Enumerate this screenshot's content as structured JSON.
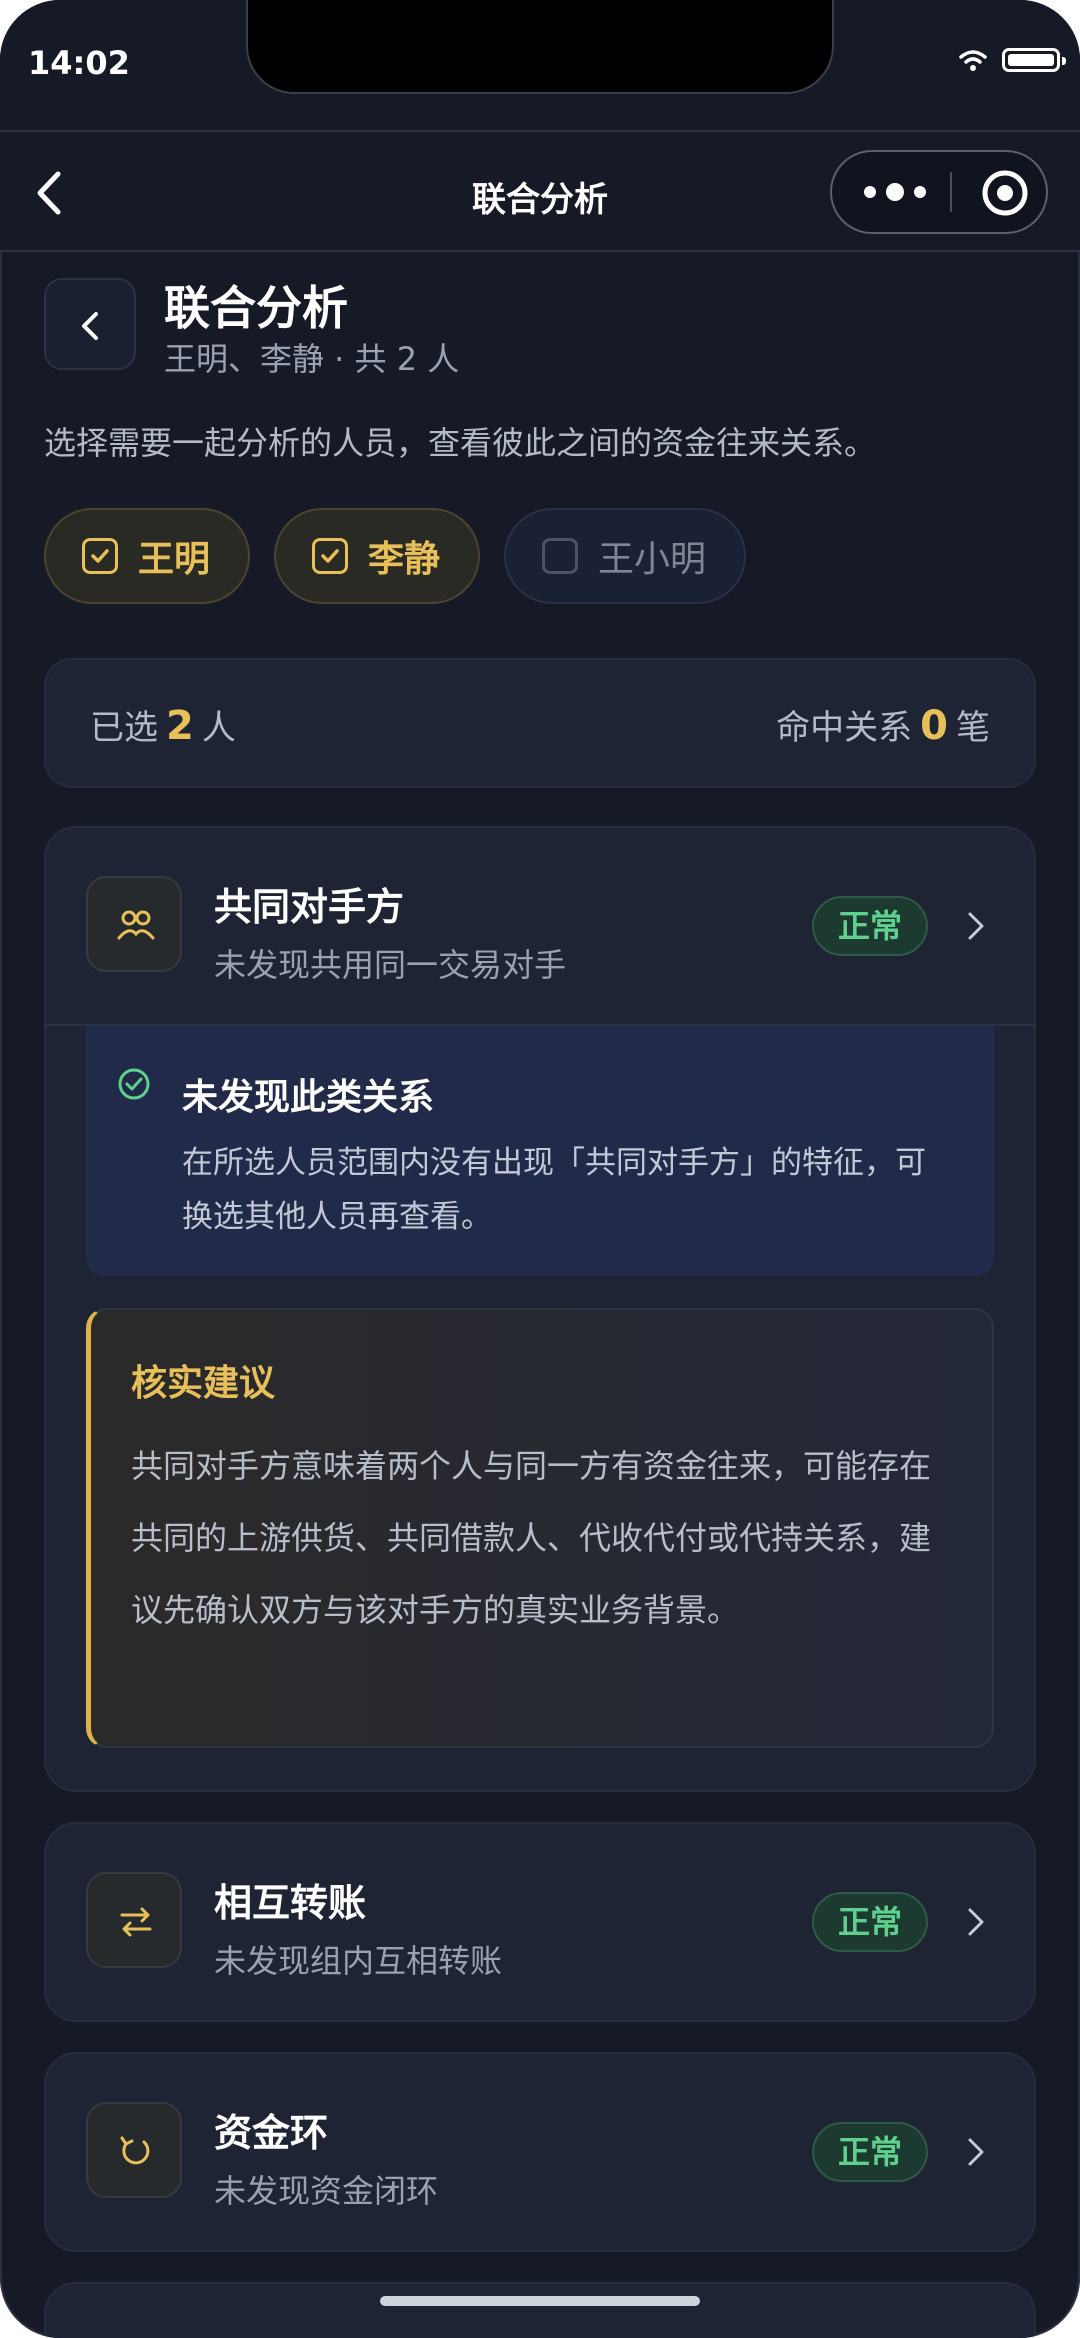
{
  "status_bar": {
    "time": "14:02"
  },
  "nav": {
    "title": "联合分析"
  },
  "page_header": {
    "title": "联合分析",
    "subtitle": "王明、李静 · 共 2 人",
    "description": "选择需要一起分析的人员，查看彼此之间的资金往来关系。"
  },
  "people": [
    {
      "name": "王明",
      "checked": true
    },
    {
      "name": "李静",
      "checked": true
    },
    {
      "name": "王小明",
      "checked": false
    }
  ],
  "summary": {
    "selected_prefix": "已选",
    "selected_count": "2",
    "selected_suffix": "人",
    "hit_prefix": "命中关系",
    "hit_count": "0",
    "hit_suffix": "笔"
  },
  "cards": [
    {
      "title": "共同对手方",
      "subtitle": "未发现共用同一交易对手",
      "status": "正常",
      "icon": "people-icon"
    },
    {
      "title": "相互转账",
      "subtitle": "未发现组内互相转账",
      "status": "正常",
      "icon": "transfer-icon"
    },
    {
      "title": "资金环",
      "subtitle": "未发现资金闭环",
      "status": "正常",
      "icon": "cycle-icon"
    }
  ],
  "no_relation": {
    "title": "未发现此类关系",
    "text": "在所选人员范围内没有出现「共同对手方」的特征，可换选其他人员再查看。"
  },
  "advice": {
    "title": "核实建议",
    "text": "共同对手方意味着两个人与同一方有资金往来，可能存在共同的上游供货、共同借款人、代收代付或代持关系，建议先确认双方与该对手方的真实业务背景。"
  },
  "colors": {
    "background": "#151a26",
    "card": "#1e2434",
    "accent_gold": "#e8c05a",
    "status_green": "#5fd08e",
    "info_blue": "#222a4a"
  }
}
